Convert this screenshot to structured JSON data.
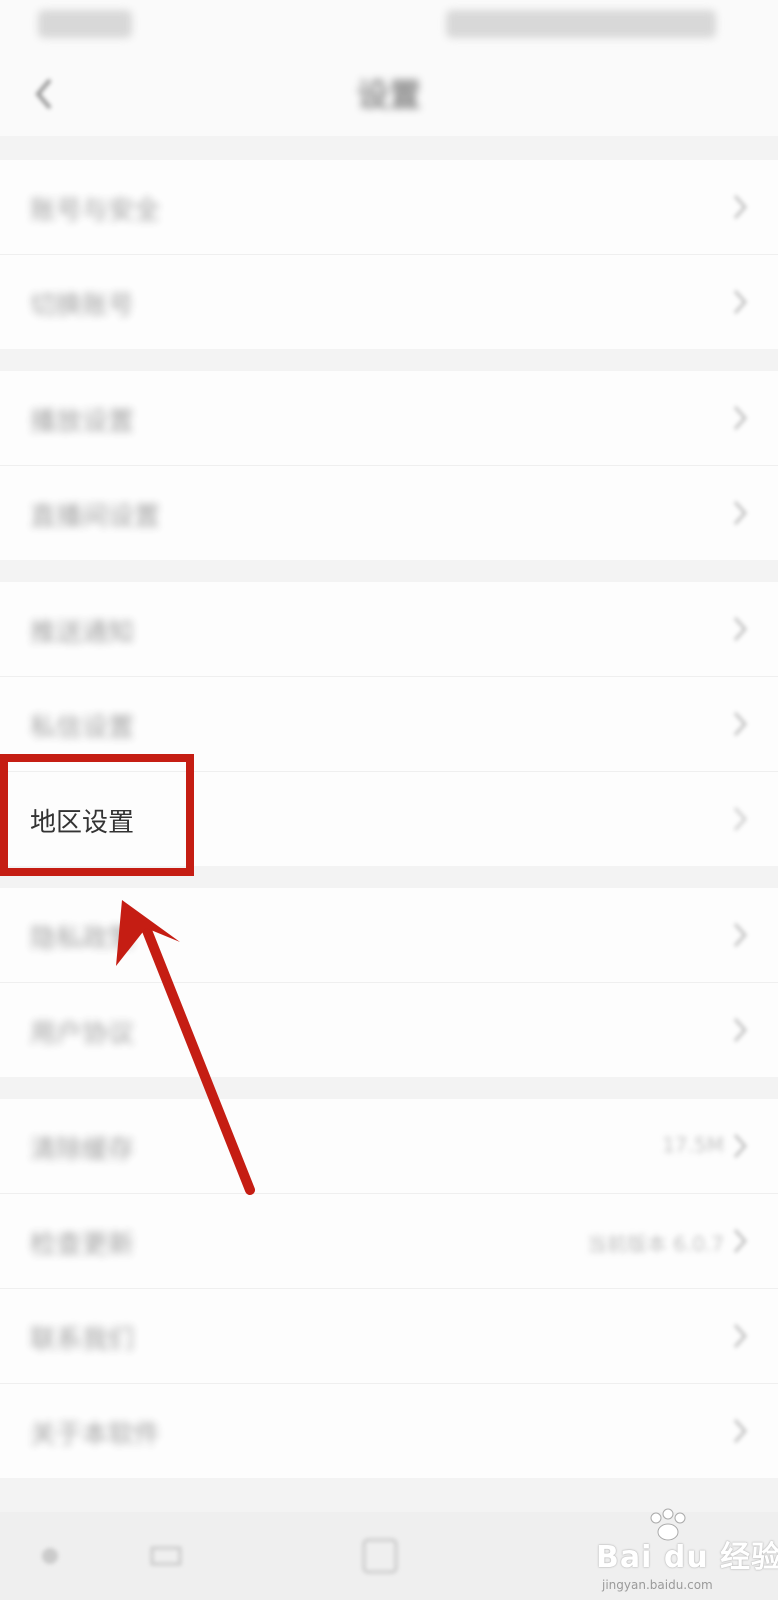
{
  "nav": {
    "title": "设置"
  },
  "groups": [
    {
      "items": [
        {
          "label": "账号与安全"
        },
        {
          "label": "切换账号"
        }
      ]
    },
    {
      "items": [
        {
          "label": "播放设置"
        },
        {
          "label": "直播间设置"
        }
      ]
    },
    {
      "items": [
        {
          "label": "推送通知"
        },
        {
          "label": "私信设置"
        },
        {
          "label": "地区设置",
          "focused": true
        }
      ]
    },
    {
      "items": [
        {
          "label": "隐私政策"
        },
        {
          "label": "用户协议"
        }
      ]
    },
    {
      "items": [
        {
          "label": "清除缓存",
          "value": "17.5M"
        },
        {
          "label": "检查更新",
          "value": "当前版本 6.0.7"
        },
        {
          "label": "联系我们"
        },
        {
          "label": "关于本软件"
        }
      ]
    }
  ],
  "watermark": {
    "brand": "Bai du 经验",
    "url": "jingyan.baidu.com"
  },
  "colors": {
    "annotation": "#c51d13",
    "background": "#f3f3f3"
  }
}
